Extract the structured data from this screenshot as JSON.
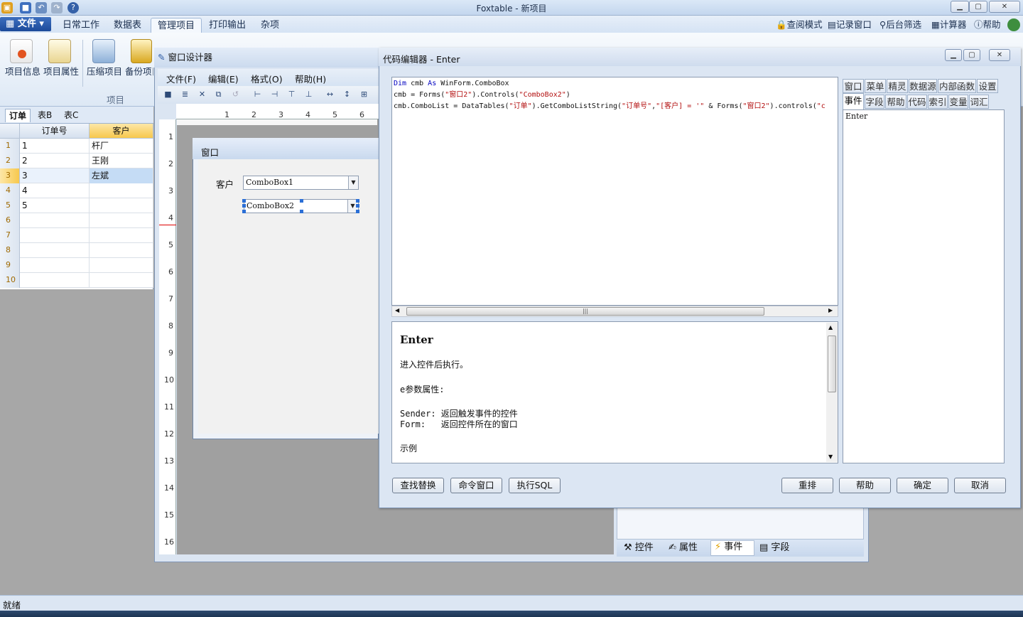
{
  "app": {
    "title": "Foxtable - 新项目",
    "file_menu": "文件"
  },
  "ribbon": {
    "tabs": [
      "日常工作",
      "数据表",
      "管理项目",
      "打印输出",
      "杂项"
    ],
    "active_tab": "管理项目",
    "right_tools": [
      "查阅模式",
      "记录窗口",
      "后台筛选",
      "计算器",
      "帮助"
    ],
    "buttons": [
      "项目信息",
      "项目属性",
      "压缩项目",
      "备份项目"
    ],
    "group_label": "项目"
  },
  "sheet": {
    "tabs": [
      "订单",
      "表B",
      "表C"
    ],
    "columns": [
      "订单号",
      "客户"
    ],
    "row_numbers": [
      "1",
      "2",
      "3",
      "4",
      "5",
      "6",
      "7",
      "8",
      "9",
      "10"
    ],
    "rows": [
      [
        "1",
        "杆厂"
      ],
      [
        "2",
        "王刚"
      ],
      [
        "3",
        "左斌"
      ],
      [
        "4",
        ""
      ],
      [
        "5",
        ""
      ],
      [
        "",
        ""
      ],
      [
        "",
        ""
      ],
      [
        "",
        ""
      ],
      [
        "",
        ""
      ],
      [
        "",
        ""
      ]
    ]
  },
  "designer": {
    "title": "窗口设计器",
    "menus": [
      "文件(F)",
      "编辑(E)",
      "格式(O)",
      "帮助(H)"
    ],
    "ruler_top": [
      "1",
      "2",
      "3",
      "4",
      "5",
      "6"
    ],
    "ruler_left": [
      "1",
      "2",
      "3",
      "4",
      "5",
      "6",
      "7",
      "8",
      "9",
      "10",
      "11",
      "12",
      "13",
      "14",
      "15",
      "16"
    ],
    "form": {
      "title": "窗口",
      "label": "客户",
      "combo1": "ComboBox1",
      "combo2": "ComboBox2"
    },
    "bottom_tabs": [
      "控件",
      "属性",
      "事件",
      "字段"
    ]
  },
  "editor": {
    "title": "代码编辑器 - Enter",
    "code_lines": [
      "Dim cmb As WinForm.ComboBox",
      "cmb = Forms(\"窗口2\").Controls(\"ComboBox2\")",
      "cmb.ComboList = DataTables(\"订单\").GetComboListString(\"订单号\",\"[客户] = '\" & Forms(\"窗口2\").controls(\"c"
    ],
    "help_lines": [
      "Enter",
      "进入控件后执行。",
      "e参数属性:",
      "Sender: 返回触发事件的控件",
      "Form:   返回控件所在的窗口",
      "示例"
    ],
    "tabs_row1": [
      "窗口",
      "菜单",
      "精灵",
      "数据源",
      "内部函数",
      "设置"
    ],
    "tabs_row2": [
      "事件",
      "字段",
      "帮助",
      "代码",
      "索引",
      "变量",
      "词汇"
    ],
    "active_tab": "事件",
    "list_items": [
      "Enter"
    ],
    "buttons_left": [
      "查找替换",
      "命令窗口",
      "执行SQL"
    ],
    "buttons_right": [
      "重排",
      "帮助",
      "确定",
      "取消"
    ]
  },
  "status": {
    "text": "就绪"
  }
}
